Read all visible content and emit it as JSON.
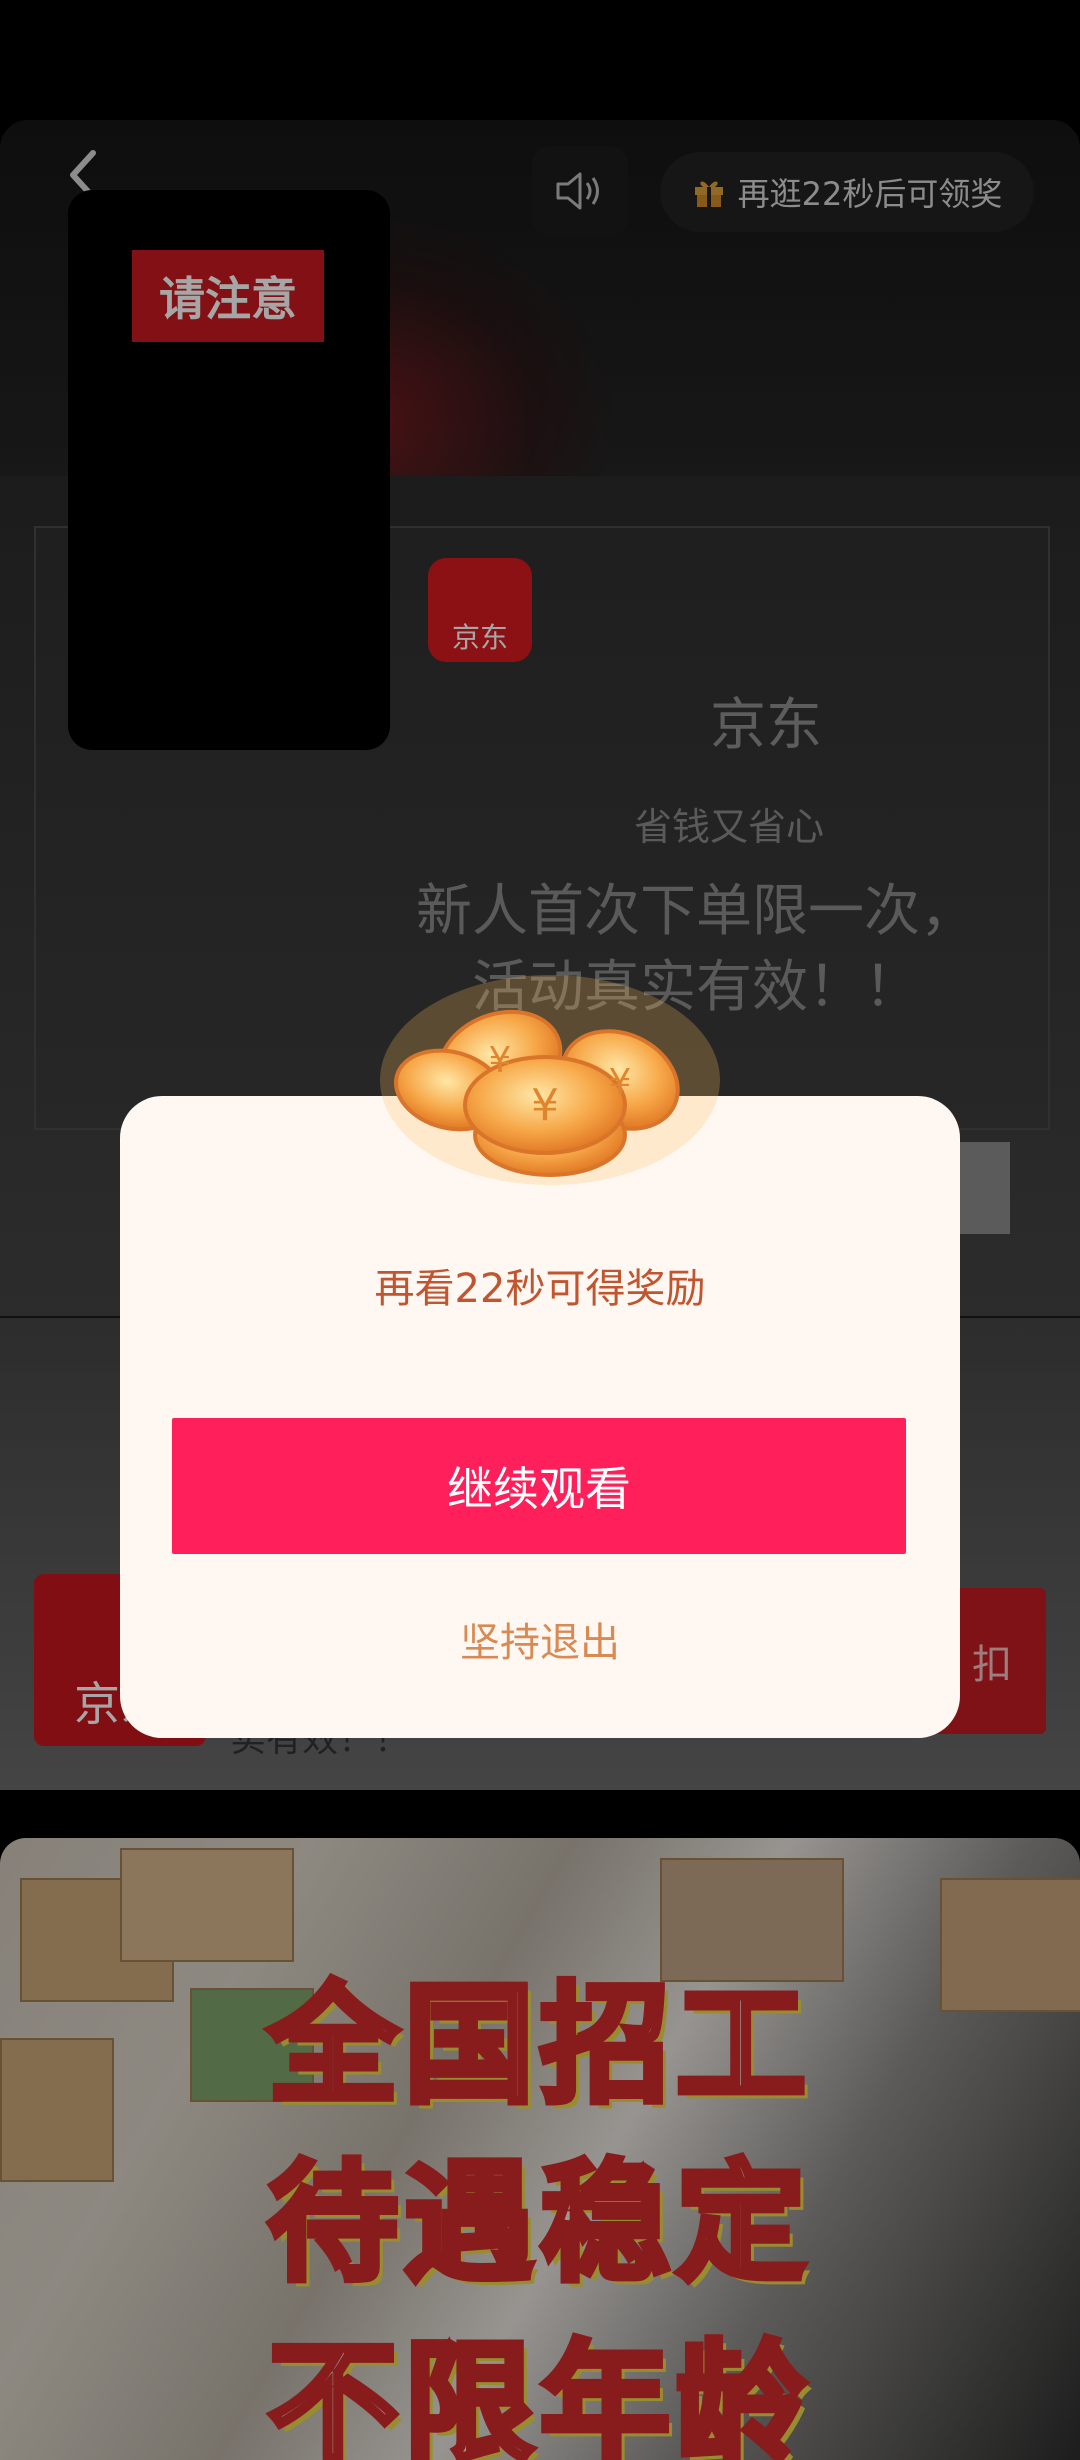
{
  "top_bar": {
    "reward_countdown": "再逛22秒后可领奖"
  },
  "ad": {
    "notice_label": "请注意",
    "logo_text": "京东",
    "brand_name": "京东",
    "slogan": "省钱又省心",
    "promo_line1": "新人首次下单限一次，",
    "promo_line2": "活动真实有效！！",
    "bottom_logo_text": "京东",
    "bottom_cta_text": "扣",
    "bottom_desc": "实有效！！"
  },
  "job_ad": {
    "lines": [
      "全国招工",
      "待遇稳定",
      "不限年龄"
    ]
  },
  "dialog": {
    "title": "再看22秒可得奖励",
    "continue_label": "继续观看",
    "exit_label": "坚持退出"
  },
  "colors": {
    "primary_button": "#ff1f5a",
    "dialog_bg": "#fff7f2",
    "title_text": "#c0552f",
    "exit_text": "#d98a53"
  },
  "icons": [
    "back-arrow-icon",
    "speaker-icon",
    "gift-icon",
    "coins-icon"
  ]
}
